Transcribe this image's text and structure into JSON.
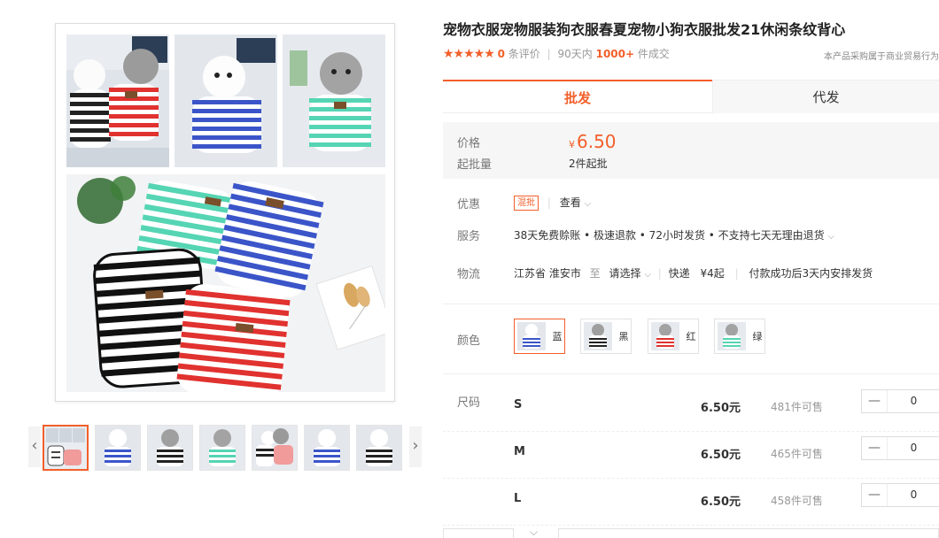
{
  "product": {
    "title": "宠物衣服宠物服装狗衣服春夏宠物小狗衣服批发21休闲条纹背心",
    "rating_stars": "★★★★★",
    "review_count": "0",
    "review_suffix": "条评价",
    "period": "90天内",
    "sold_count": "1000+",
    "sold_suffix": "件成交",
    "biz_note": "本产品采购属于商业贸易行为"
  },
  "tabs": [
    {
      "label": "批发",
      "active": true
    },
    {
      "label": "代发",
      "active": false
    }
  ],
  "pricing": {
    "price_label": "价格",
    "currency": "¥",
    "price": "6.50",
    "moq_label": "起批量",
    "moq_value": "2件起批"
  },
  "promo": {
    "label": "优惠",
    "tag": "混批",
    "view": "查看"
  },
  "service": {
    "label": "服务",
    "text": "38天免费赊账 • 极速退款 • 72小时发货 • 不支持七天无理由退货"
  },
  "logistics": {
    "label": "物流",
    "origin": "江苏省 淮安市",
    "to": "至",
    "dest": "请选择",
    "express": "快递",
    "fee": "¥4起",
    "dispatch": "付款成功后3天内安排发货"
  },
  "colors": {
    "label": "颜色",
    "options": [
      {
        "name": "蓝",
        "active": true,
        "stripe": "#3b55c9"
      },
      {
        "name": "黑",
        "active": false,
        "stripe": "#222222"
      },
      {
        "name": "红",
        "active": false,
        "stripe": "#e0322f"
      },
      {
        "name": "绿",
        "active": false,
        "stripe": "#55d5b3"
      }
    ]
  },
  "sizes": {
    "label": "尺码",
    "rows": [
      {
        "size": "S",
        "price": "6.50元",
        "stock": "481件可售",
        "qty": "0"
      },
      {
        "size": "M",
        "price": "6.50元",
        "stock": "465件可售",
        "qty": "0"
      },
      {
        "size": "L",
        "price": "6.50元",
        "stock": "458件可售",
        "qty": "0"
      }
    ],
    "minus": "—"
  },
  "gallery": {
    "prev": "‹",
    "next": "›",
    "thumb_count": 7
  },
  "accent_color": "#f25f2a"
}
